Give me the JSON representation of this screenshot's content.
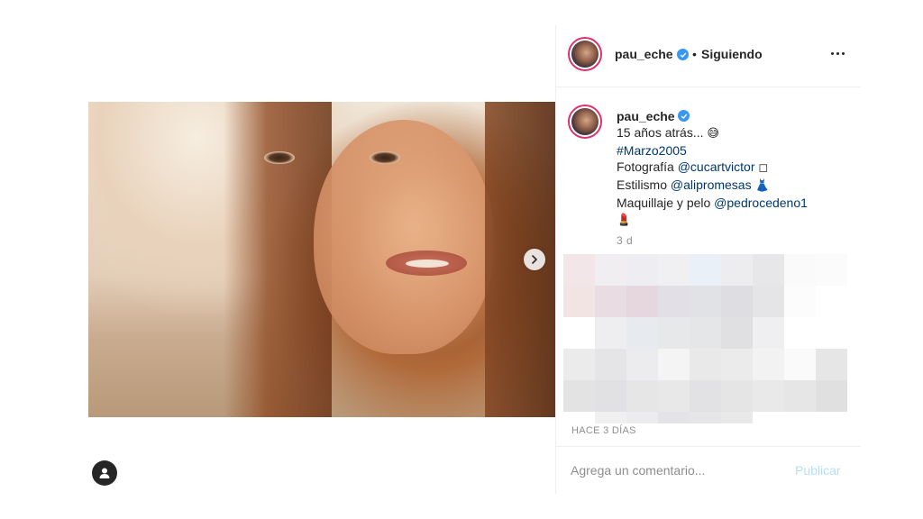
{
  "post": {
    "username": "pau_eche",
    "separator": "•",
    "follow_status": "Siguiendo",
    "caption": {
      "line1": "15 años atrás... ",
      "line1_emoji": "😅",
      "hashtag": "#Marzo2005",
      "photo_prefix": "Fotografía ",
      "photo_mention": "@cucartvictor",
      "photo_emoji": "◻",
      "style_prefix": "Estilismo ",
      "style_mention": "@alipromesas",
      "style_emoji": "👗",
      "makeup_prefix": "Maquillaje y pelo ",
      "makeup_mention": "@pedrocedeno1",
      "makeup_emoji": "💄"
    },
    "caption_time": "3 d",
    "post_time": "HACE 3 DÍAS"
  },
  "comment": {
    "placeholder": "Agrega un comentario...",
    "publish_label": "Publicar"
  },
  "icons": {
    "verified": "verified-badge-icon",
    "next": "chevron-right-icon",
    "more": "more-options-icon",
    "user": "user-profile-icon"
  },
  "colors": {
    "verified": "#3897f0",
    "link": "#00376b",
    "publish_disabled": "#b2dffc",
    "muted": "#8e8e8e"
  }
}
